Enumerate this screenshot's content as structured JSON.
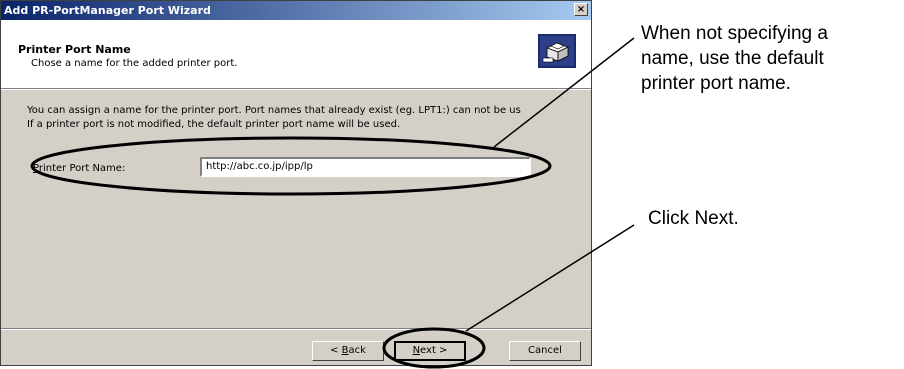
{
  "dialog": {
    "title": "Add PR-PortManager Port Wizard",
    "close_label": "×",
    "header_title": "Printer Port Name",
    "header_subtitle": "Chose a name for the added printer port.",
    "body_line1": "You can assign a name for the printer port. Port names that already exist (eg. LPT1:) can not be us",
    "body_line2": "If a printer port is not modified, the default printer port name will be used.",
    "field_label_accel": "P",
    "field_label_rest": "rinter Port Name:",
    "field_value": "http://abc.co.jp/ipp/lp",
    "back_prefix": "< ",
    "back_accel": "B",
    "back_rest": "ack",
    "next_accel": "N",
    "next_rest": "ext >",
    "cancel_label": "Cancel"
  },
  "annotations": {
    "top_line1": "When not specifying a",
    "top_line2": "name, use the default",
    "top_line3": "printer port name.",
    "bottom": "Click Next."
  },
  "icons": {
    "logo": "printer-wizard-icon"
  }
}
